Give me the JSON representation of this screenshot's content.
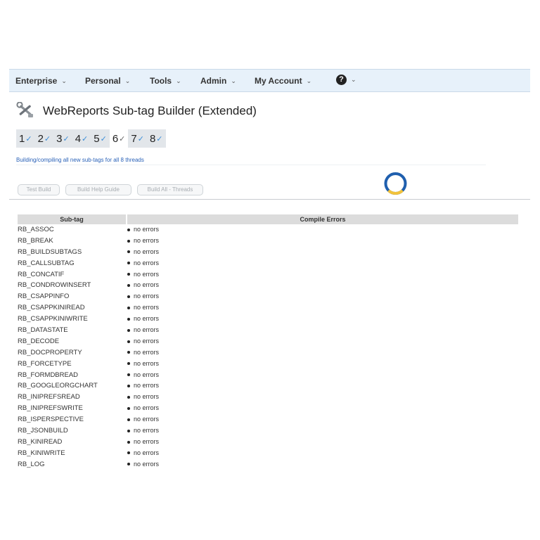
{
  "nav": {
    "items": [
      {
        "label": "Enterprise"
      },
      {
        "label": "Personal"
      },
      {
        "label": "Tools"
      },
      {
        "label": "Admin"
      },
      {
        "label": "My Account"
      }
    ],
    "help_symbol": "?"
  },
  "page": {
    "title": "WebReports Sub-tag Builder (Extended)",
    "title_icon": "tools-icon"
  },
  "threads": {
    "steps": [
      {
        "label": "1",
        "state": "done"
      },
      {
        "label": "2",
        "state": "done"
      },
      {
        "label": "3",
        "state": "done"
      },
      {
        "label": "4",
        "state": "done"
      },
      {
        "label": "5",
        "state": "done"
      },
      {
        "label": "6",
        "state": "active"
      },
      {
        "label": "7",
        "state": "done"
      },
      {
        "label": "8",
        "state": "done"
      }
    ],
    "check_glyph": "✓"
  },
  "status": {
    "text": "Building/compiling all new sub-tags for all 8 threads"
  },
  "buttons": {
    "test_build": "Test Build",
    "build_help_guide": "Build Help Guide",
    "build_all_threads": "Build All - Threads"
  },
  "spinner": {
    "colors": {
      "ring": "#1f5fae",
      "accent": "#f2c23a"
    }
  },
  "table": {
    "headers": {
      "subtag": "Sub-tag",
      "errors": "Compile Errors"
    },
    "rows": [
      {
        "tag": "RB_ASSOC",
        "errors": "no errors"
      },
      {
        "tag": "RB_BREAK",
        "errors": "no errors"
      },
      {
        "tag": "RB_BUILDSUBTAGS",
        "errors": "no errors"
      },
      {
        "tag": "RB_CALLSUBTAG",
        "errors": "no errors"
      },
      {
        "tag": "RB_CONCATIF",
        "errors": "no errors"
      },
      {
        "tag": "RB_CONDROWINSERT",
        "errors": "no errors"
      },
      {
        "tag": "RB_CSAPPINFO",
        "errors": "no errors"
      },
      {
        "tag": "RB_CSAPPKINIREAD",
        "errors": "no errors"
      },
      {
        "tag": "RB_CSAPPKINIWRITE",
        "errors": "no errors"
      },
      {
        "tag": "RB_DATASTATE",
        "errors": "no errors"
      },
      {
        "tag": "RB_DECODE",
        "errors": "no errors"
      },
      {
        "tag": "RB_DOCPROPERTY",
        "errors": "no errors"
      },
      {
        "tag": "RB_FORCETYPE",
        "errors": "no errors"
      },
      {
        "tag": "RB_FORMDBREAD",
        "errors": "no errors"
      },
      {
        "tag": "RB_GOOGLEORGCHART",
        "errors": "no errors"
      },
      {
        "tag": "RB_INIPREFSREAD",
        "errors": "no errors"
      },
      {
        "tag": "RB_INIPREFSWRITE",
        "errors": "no errors"
      },
      {
        "tag": "RB_ISPERSPECTIVE",
        "errors": "no errors"
      },
      {
        "tag": "RB_JSONBUILD",
        "errors": "no errors"
      },
      {
        "tag": "RB_KINIREAD",
        "errors": "no errors"
      },
      {
        "tag": "RB_KINIWRITE",
        "errors": "no errors"
      },
      {
        "tag": "RB_LOG",
        "errors": "no errors"
      }
    ]
  }
}
